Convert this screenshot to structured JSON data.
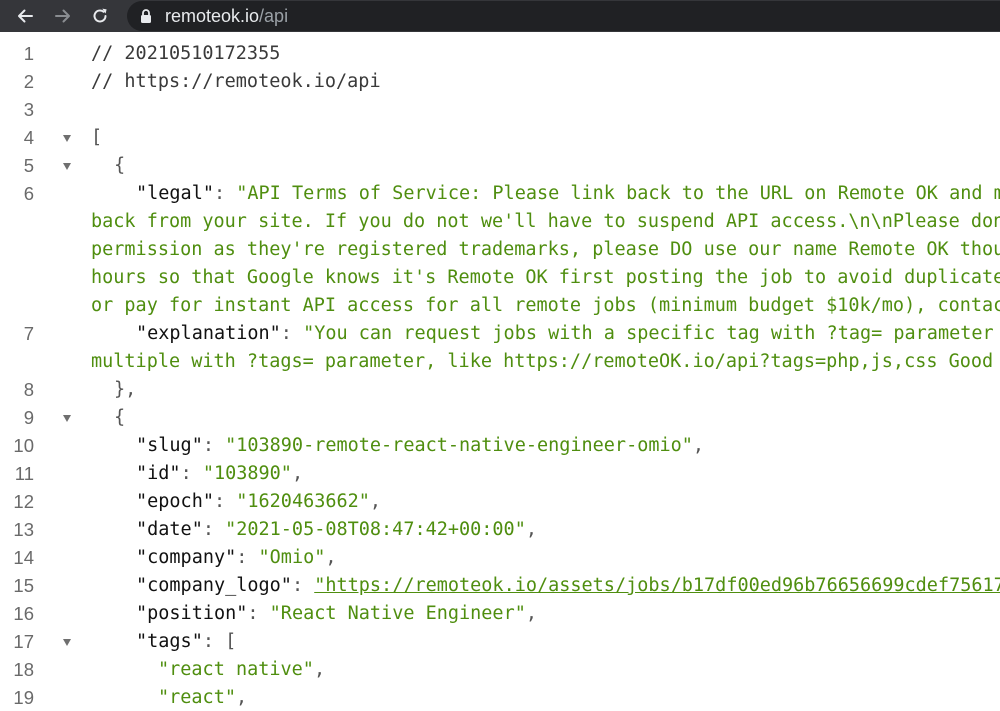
{
  "browser": {
    "url_host": "remoteok.io",
    "url_path": "/api"
  },
  "lines": [
    {
      "n": "1",
      "text": "// 20210510172355"
    },
    {
      "n": "2",
      "text": "// https://remoteok.io/api"
    },
    {
      "n": "3",
      "text": ""
    },
    {
      "n": "4",
      "text": "["
    },
    {
      "n": "5",
      "text": "{"
    },
    {
      "n": "6",
      "key": "\"legal\"",
      "value": "\"API Terms of Service: Please link back to the URL on Remote OK and m",
      "cont": [
        "back from your site. If you do not we'll have to suspend API access.\\n\\nPlease don",
        "permission as they're registered trademarks, please DO use our name Remote OK thou",
        "hours so that Google knows it's Remote OK first posting the job to avoid duplicate",
        "or pay for instant API access for all remote jobs (minimum budget $10k/mo), contac"
      ]
    },
    {
      "n": "7",
      "key": "\"explanation\"",
      "value": "\"You can request jobs with a specific tag with ?tag= parameter",
      "cont": [
        "multiple with ?tags= parameter, like https://remoteOK.io/api?tags=php,js,css Good"
      ]
    },
    {
      "n": "8",
      "text": "},"
    },
    {
      "n": "9",
      "text": "{"
    },
    {
      "n": "10",
      "key": "\"slug\"",
      "value": "\"103890-remote-react-native-engineer-omio\""
    },
    {
      "n": "11",
      "key": "\"id\"",
      "value": "\"103890\""
    },
    {
      "n": "12",
      "key": "\"epoch\"",
      "value": "\"1620463662\""
    },
    {
      "n": "13",
      "key": "\"date\"",
      "value": "\"2021-05-08T08:47:42+00:00\""
    },
    {
      "n": "14",
      "key": "\"company\"",
      "value": "\"Omio\""
    },
    {
      "n": "15",
      "key": "\"company_logo\"",
      "link": "\"https://remoteok.io/assets/jobs/b17df00ed96b76656699cdef75617"
    },
    {
      "n": "16",
      "key": "\"position\"",
      "value": "\"React Native Engineer\""
    },
    {
      "n": "17",
      "key": "\"tags\"",
      "text": "["
    },
    {
      "n": "18",
      "value": "\"react native\""
    },
    {
      "n": "19",
      "value": "\"react\""
    }
  ]
}
